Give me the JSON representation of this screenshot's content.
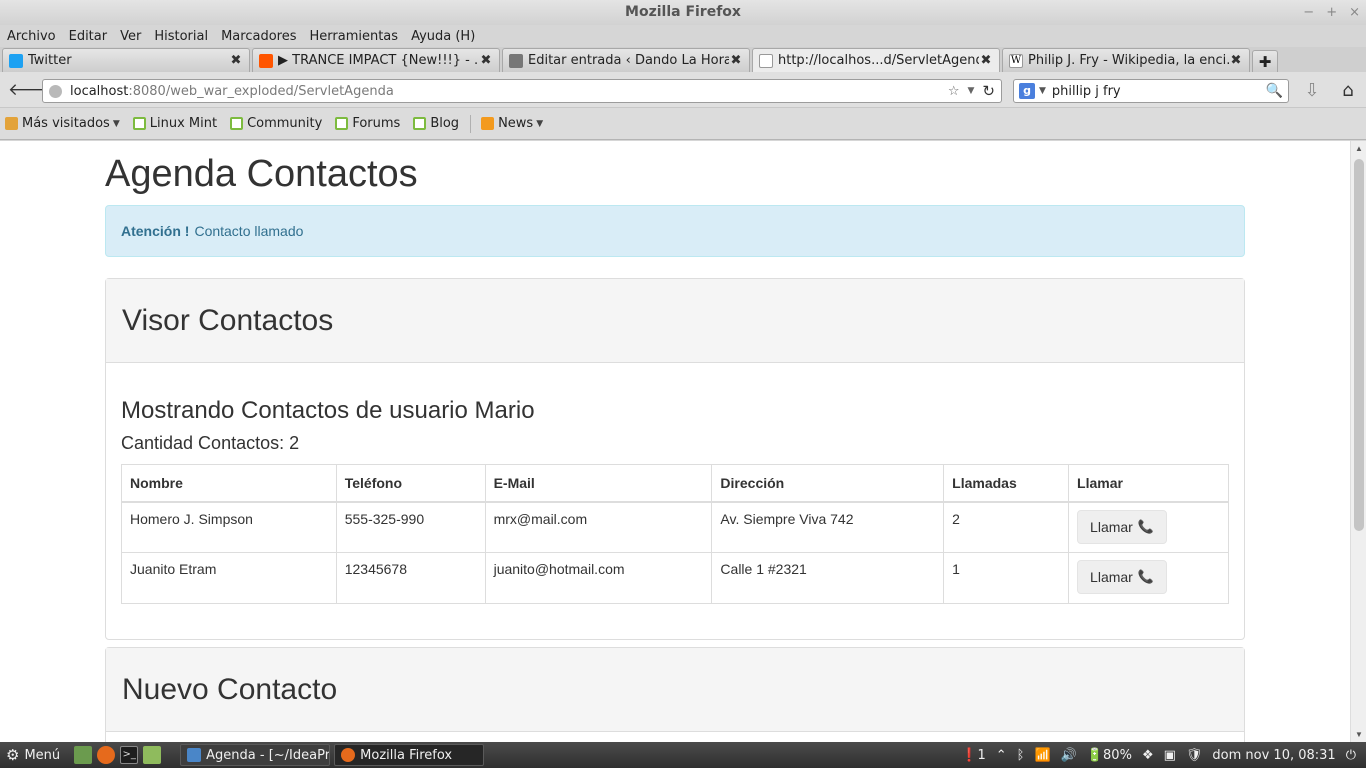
{
  "window": {
    "title": "Mozilla Firefox",
    "controls": {
      "minimize": "−",
      "maximize": "+",
      "close": "×"
    }
  },
  "menu": [
    "Archivo",
    "Editar",
    "Ver",
    "Historial",
    "Marcadores",
    "Herramientas",
    "Ayuda (H)"
  ],
  "tabs": [
    {
      "label": "Twitter",
      "icon": "twitter-icon",
      "color": "#1da1f2"
    },
    {
      "label": "▶ TRANCE IMPACT {New!!!} - ...",
      "icon": "soundcloud-icon",
      "color": "#ff5500"
    },
    {
      "label": "Editar entrada ‹ Dando La Hora...",
      "icon": "wordpress-icon",
      "color": "#777777"
    },
    {
      "label": "http://localhos...d/ServletAgenda",
      "icon": "blank-page-icon",
      "color": "#ffffff"
    },
    {
      "label": "Philip J. Fry - Wikipedia, la enci...",
      "icon": "wikipedia-icon",
      "color": "#ffffff"
    }
  ],
  "tab_close": "✖",
  "new_tab": "✚",
  "navbar": {
    "back": "🡐",
    "url_host": "localhost",
    "url_rest": ":8080/web_war_exploded/ServletAgenda",
    "star": "☆",
    "dropdown": "▼",
    "reload": "↻",
    "search_engine": "g",
    "search_caret": "▼",
    "search_value": "phillip j fry",
    "search_icon": "🔍",
    "download": "⇩",
    "home": "⌂"
  },
  "bookmarks": [
    {
      "label": "Más visitados",
      "icon": "folder",
      "caret": "▼"
    },
    {
      "label": "Linux Mint",
      "icon": "mint"
    },
    {
      "label": "Community",
      "icon": "mint"
    },
    {
      "label": "Forums",
      "icon": "mint"
    },
    {
      "label": "Blog",
      "icon": "mint"
    },
    {
      "label": "News",
      "icon": "rss",
      "caret": "▼"
    }
  ],
  "page": {
    "title": "Agenda Contactos",
    "alert": {
      "strong": "Atención !",
      "message": "Contacto llamado",
      "color": "#31708f"
    },
    "viewer_panel": {
      "heading": "Visor Contactos",
      "subtitle": "Mostrando Contactos de usuario Mario",
      "count_label": "Cantidad Contactos:",
      "count_value": "2",
      "columns": [
        "Nombre",
        "Teléfono",
        "E-Mail",
        "Dirección",
        "Llamadas",
        "Llamar"
      ],
      "rows": [
        {
          "nombre": "Homero J. Simpson",
          "telefono": "555-325-990",
          "email": "mrx@mail.com",
          "direccion": "Av. Siempre Viva 742",
          "llamadas": "2",
          "action": "Llamar"
        },
        {
          "nombre": "Juanito Etram",
          "telefono": "12345678",
          "email": "juanito@hotmail.com",
          "direccion": "Calle 1 #2321",
          "llamadas": "1",
          "action": "Llamar"
        }
      ],
      "phone_icon": "📞"
    },
    "new_panel": {
      "heading": "Nuevo Contacto"
    }
  },
  "taskbar": {
    "menu_label": "Menú",
    "gear": "⚙",
    "terminal_glyph": ">_",
    "tasks": [
      {
        "label": "Agenda - [~/IdeaPr...",
        "icon": "intellij-icon",
        "color": "#4a86c8"
      },
      {
        "label": "Mozilla Firefox",
        "icon": "firefox-icon",
        "color": "#e66a1c"
      }
    ],
    "tray": {
      "alert": "❗1",
      "chevron": "⌃",
      "bluetooth": "ᛒ",
      "wifi": "📶",
      "volume": "🔊",
      "battery": "🔋80%",
      "dropbox": "❖",
      "monitor": "▣",
      "shield": "🛡",
      "clock": "dom nov 10, 08:31",
      "power": "⏻"
    }
  }
}
